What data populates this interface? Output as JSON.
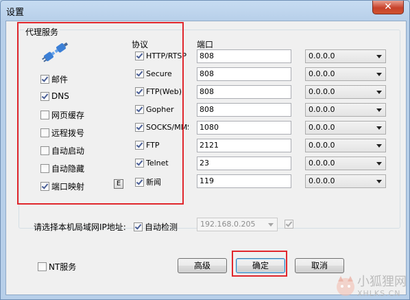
{
  "window": {
    "title": "设置",
    "close_glyph": "✕"
  },
  "proxy_group": {
    "legend": "代理服务",
    "icon": "plug-icon",
    "services": [
      {
        "label": "邮件",
        "checked": true
      },
      {
        "label": "DNS",
        "checked": true
      },
      {
        "label": "网页缓存",
        "checked": false
      },
      {
        "label": "远程拨号",
        "checked": false
      },
      {
        "label": "自动启动",
        "checked": false
      },
      {
        "label": "自动隐藏",
        "checked": false
      },
      {
        "label": "端口映射",
        "checked": true
      }
    ],
    "port_map_button": "E",
    "protocol_header": "协议",
    "port_header": "端口",
    "protocols": [
      {
        "label": "HTTP/RTSP",
        "checked": true,
        "port": "808",
        "ip": "0.0.0.0"
      },
      {
        "label": "Secure",
        "checked": true,
        "port": "808",
        "ip": "0.0.0.0"
      },
      {
        "label": "FTP(Web)",
        "checked": true,
        "port": "808",
        "ip": "0.0.0.0"
      },
      {
        "label": "Gopher",
        "checked": true,
        "port": "808",
        "ip": "0.0.0.0"
      },
      {
        "label": "SOCKS/MMS",
        "checked": true,
        "port": "1080",
        "ip": "0.0.0.0"
      },
      {
        "label": "FTP",
        "checked": true,
        "port": "2121",
        "ip": "0.0.0.0"
      },
      {
        "label": "Telnet",
        "checked": true,
        "port": "23",
        "ip": "0.0.0.0"
      },
      {
        "label": "新闻",
        "checked": true,
        "port": "119",
        "ip": "0.0.0.0"
      }
    ]
  },
  "lan": {
    "label": "请选择本机局域网IP地址:",
    "auto_detect_label": "自动检测",
    "auto_detect_checked": true,
    "ip_value": "192.168.0.205",
    "extra_checked": true
  },
  "footer": {
    "nt_service_label": "NT服务",
    "nt_service_checked": false,
    "advanced_button": "高级",
    "ok_button": "确定",
    "cancel_button": "取消"
  },
  "watermark": {
    "text": "小狐狸网",
    "sub": "XHLKS.CN"
  },
  "colors": {
    "highlight": "#e0262c",
    "titlebar": "#b9d1ea",
    "close": "#c7422b"
  }
}
